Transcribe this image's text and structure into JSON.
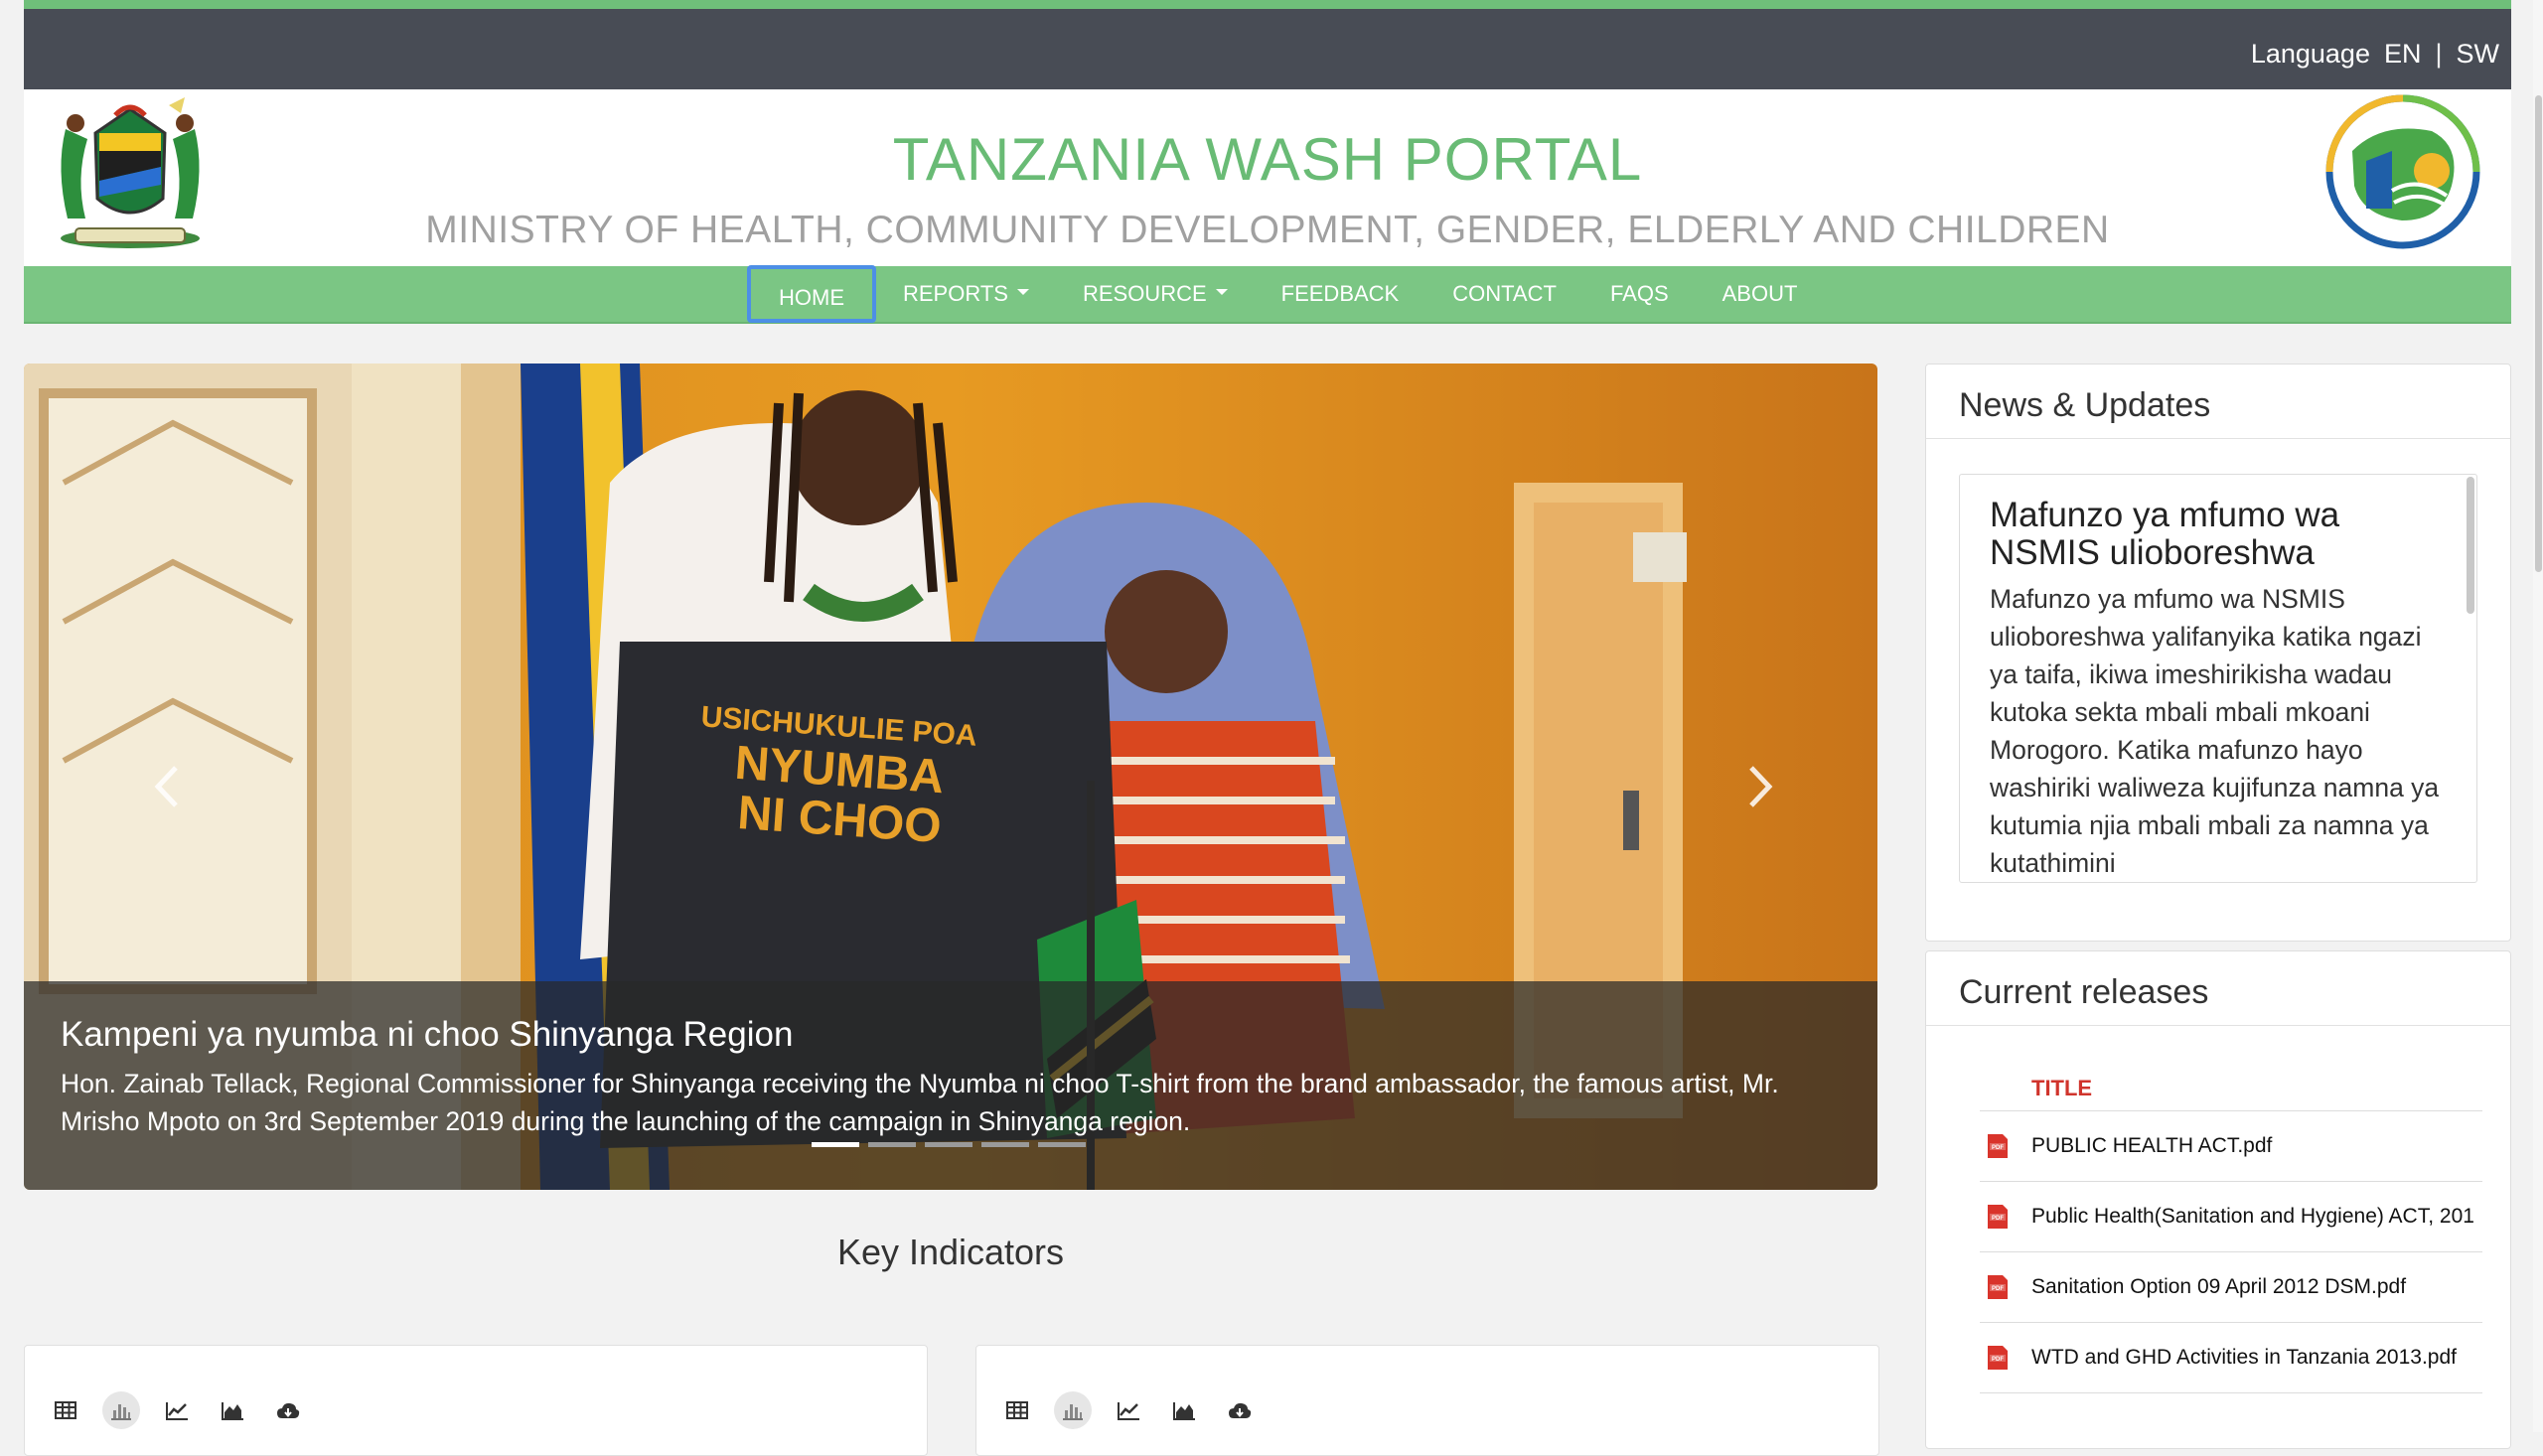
{
  "topbar": {
    "language_label": "Language",
    "lang_en": "EN",
    "separator": "|",
    "lang_sw": "SW"
  },
  "header": {
    "title": "TANZANIA WASH PORTAL",
    "subtitle": "MINISTRY OF HEALTH, COMMUNITY DEVELOPMENT, GENDER, ELDERLY AND CHILDREN"
  },
  "nav": {
    "items": [
      {
        "label": "HOME",
        "active": true
      },
      {
        "label": "REPORTS",
        "dropdown": true
      },
      {
        "label": "RESOURCE",
        "dropdown": true
      },
      {
        "label": "FEEDBACK"
      },
      {
        "label": "CONTACT"
      },
      {
        "label": "FAQS"
      },
      {
        "label": "ABOUT"
      }
    ]
  },
  "carousel": {
    "shirt_text_line1": "USICHUKULIE POA",
    "shirt_text_line2": "NYUMBA",
    "shirt_text_line3": "NI CHOO",
    "caption_title": "Kampeni ya nyumba ni choo Shinyanga Region",
    "caption_text": "Hon. Zainab Tellack, Regional Commissioner for Shinyanga receiving the Nyumba ni choo T-shirt from the brand ambassador, the famous artist, Mr. Mrisho Mpoto on 3rd September 2019 during the launching of the campaign in Shinyanga region.",
    "slide_count": 5,
    "active_slide": 1
  },
  "key_indicators": {
    "title": "Key Indicators"
  },
  "news": {
    "title": "News & Updates",
    "item_heading": "Mafunzo ya mfumo wa NSMIS ulioboreshwa",
    "item_body": "Mafunzo ya mfumo wa NSMIS ulioboreshwa yalifanyika katika ngazi ya taifa, ikiwa imeshirikisha wadau kutoka sekta mbali mbali mkoani Morogoro. Katika mafunzo hayo washiriki waliweza kujifunza namna ya kutumia njia mbali mbali za namna ya kutathimini"
  },
  "releases": {
    "title": "Current releases",
    "column_title": "TITLE",
    "items": [
      "PUBLIC HEALTH ACT.pdf",
      "Public Health(Sanitation and Hygiene) ACT, 201",
      "Sanitation Option 09 April 2012 DSM.pdf",
      "WTD and GHD Activities in Tanzania 2013.pdf"
    ]
  },
  "colors": {
    "brand_green": "#69bb75",
    "nav_green": "#7bc684",
    "topbar": "#484c55",
    "pdf_red": "#d9342b"
  },
  "icons": [
    "table-icon",
    "bar-chart-icon",
    "line-chart-icon",
    "area-chart-icon",
    "cloud-download-icon",
    "pdf-icon",
    "chevron-left-icon",
    "chevron-right-icon"
  ]
}
